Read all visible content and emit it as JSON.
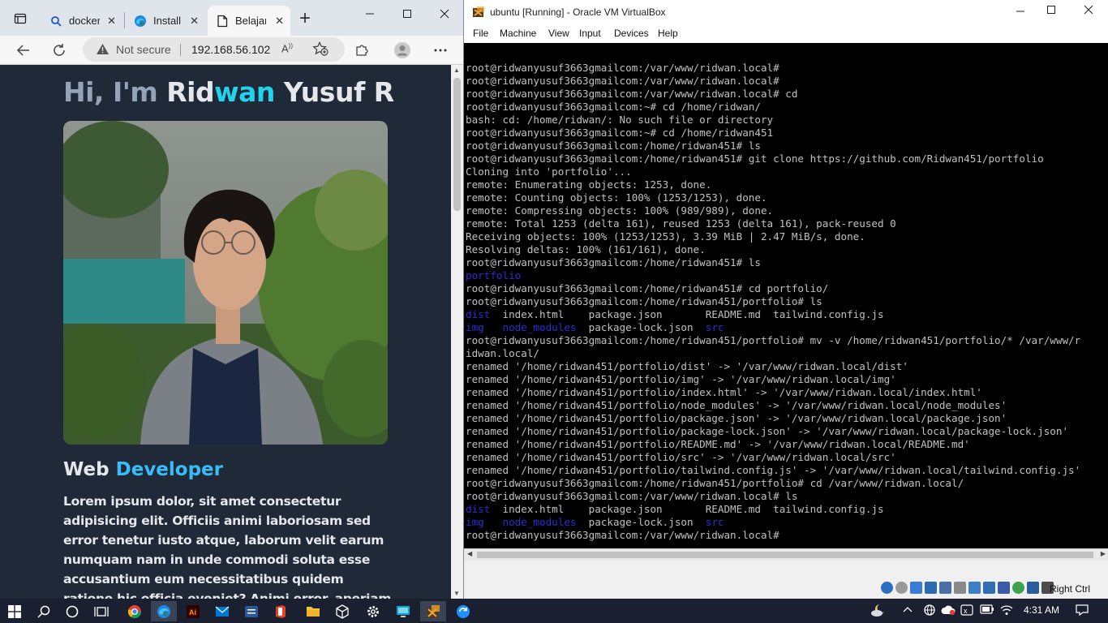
{
  "browser": {
    "tabs": [
      {
        "label": "docker",
        "icon": "search-icon"
      },
      {
        "label": "Install",
        "icon": "edge-icon"
      },
      {
        "label": "Belajar",
        "icon": "page-icon",
        "active": true
      }
    ],
    "address": {
      "security": "Not secure",
      "url": "192.168.56.102"
    },
    "page": {
      "greeting_prefix": "Hi, I'm ",
      "name_part1": "Rid",
      "name_part2": "wan",
      "name_part3": " Yusuf R",
      "role_prefix": "Web ",
      "role_accent": "Developer",
      "bio": "Lorem ipsum dolor, sit amet consectetur adipisicing elit. Officiis animi laboriosam sed error tenetur iusto atque, laborum velit earum numquam nam in unde commodi soluta esse accusantium eum necessitatibus quidem ratione hic officia eveniet? Animi error, aperiam earum tempore doloremque perferendis"
    }
  },
  "vbox": {
    "title": "ubuntu [Running] - Oracle VM VirtualBox",
    "menu": [
      "File",
      "Machine",
      "View",
      "Input",
      "Devices",
      "Help"
    ],
    "host_key": "Right Ctrl",
    "terminal_lines": [
      [
        {
          "t": "root@ridwanyusuf3663gmailcom:/var/www/ridwan.local#"
        }
      ],
      [
        {
          "t": "root@ridwanyusuf3663gmailcom:/var/www/ridwan.local#"
        }
      ],
      [
        {
          "t": "root@ridwanyusuf3663gmailcom:/var/www/ridwan.local# cd"
        }
      ],
      [
        {
          "t": "root@ridwanyusuf3663gmailcom:~# cd /home/ridwan/"
        }
      ],
      [
        {
          "t": "bash: cd: /home/ridwan/: No such file or directory"
        }
      ],
      [
        {
          "t": "root@ridwanyusuf3663gmailcom:~# cd /home/ridwan451"
        }
      ],
      [
        {
          "t": "root@ridwanyusuf3663gmailcom:/home/ridwan451# ls"
        }
      ],
      [
        {
          "t": "root@ridwanyusuf3663gmailcom:/home/ridwan451# git clone https://github.com/Ridwan451/portfolio"
        }
      ],
      [
        {
          "t": "Cloning into 'portfolio'..."
        }
      ],
      [
        {
          "t": "remote: Enumerating objects: 1253, done."
        }
      ],
      [
        {
          "t": "remote: Counting objects: 100% (1253/1253), done."
        }
      ],
      [
        {
          "t": "remote: Compressing objects: 100% (989/989), done."
        }
      ],
      [
        {
          "t": "remote: Total 1253 (delta 161), reused 1253 (delta 161), pack-reused 0"
        }
      ],
      [
        {
          "t": "Receiving objects: 100% (1253/1253), 3.39 MiB | 2.47 MiB/s, done."
        }
      ],
      [
        {
          "t": "Resolving deltas: 100% (161/161), done."
        }
      ],
      [
        {
          "t": "root@ridwanyusuf3663gmailcom:/home/ridwan451# ls"
        }
      ],
      [
        {
          "t": "portfolio",
          "c": "blue"
        }
      ],
      [
        {
          "t": "root@ridwanyusuf3663gmailcom:/home/ridwan451# cd portfolio/"
        }
      ],
      [
        {
          "t": "root@ridwanyusuf3663gmailcom:/home/ridwan451/portfolio# ls"
        }
      ],
      [
        {
          "t": "dist",
          "c": "blue"
        },
        {
          "t": "  index.html    package.json       README.md  tailwind.config.js"
        }
      ],
      [
        {
          "t": "img",
          "c": "blue"
        },
        {
          "t": "   "
        },
        {
          "t": "node_modules",
          "c": "blue"
        },
        {
          "t": "  package-lock.json  "
        },
        {
          "t": "src",
          "c": "blue"
        }
      ],
      [
        {
          "t": "root@ridwanyusuf3663gmailcom:/home/ridwan451/portfolio# mv -v /home/ridwan451/portfolio/* /var/www/r"
        }
      ],
      [
        {
          "t": "idwan.local/"
        }
      ],
      [
        {
          "t": "renamed '/home/ridwan451/portfolio/dist' -> '/var/www/ridwan.local/dist'"
        }
      ],
      [
        {
          "t": "renamed '/home/ridwan451/portfolio/img' -> '/var/www/ridwan.local/img'"
        }
      ],
      [
        {
          "t": "renamed '/home/ridwan451/portfolio/index.html' -> '/var/www/ridwan.local/index.html'"
        }
      ],
      [
        {
          "t": "renamed '/home/ridwan451/portfolio/node_modules' -> '/var/www/ridwan.local/node_modules'"
        }
      ],
      [
        {
          "t": "renamed '/home/ridwan451/portfolio/package.json' -> '/var/www/ridwan.local/package.json'"
        }
      ],
      [
        {
          "t": "renamed '/home/ridwan451/portfolio/package-lock.json' -> '/var/www/ridwan.local/package-lock.json'"
        }
      ],
      [
        {
          "t": "renamed '/home/ridwan451/portfolio/README.md' -> '/var/www/ridwan.local/README.md'"
        }
      ],
      [
        {
          "t": "renamed '/home/ridwan451/portfolio/src' -> '/var/www/ridwan.local/src'"
        }
      ],
      [
        {
          "t": "renamed '/home/ridwan451/portfolio/tailwind.config.js' -> '/var/www/ridwan.local/tailwind.config.js'"
        }
      ],
      [
        {
          "t": "root@ridwanyusuf3663gmailcom:/home/ridwan451/portfolio# cd /var/www/ridwan.local/"
        }
      ],
      [
        {
          "t": "root@ridwanyusuf3663gmailcom:/var/www/ridwan.local# ls"
        }
      ],
      [
        {
          "t": "dist",
          "c": "blue"
        },
        {
          "t": "  index.html    package.json       README.md  tailwind.config.js"
        }
      ],
      [
        {
          "t": "img",
          "c": "blue"
        },
        {
          "t": "   "
        },
        {
          "t": "node_modules",
          "c": "blue"
        },
        {
          "t": "  package-lock.json  "
        },
        {
          "t": "src",
          "c": "blue"
        }
      ],
      [
        {
          "t": "root@ridwanyusuf3663gmailcom:/var/www/ridwan.local#"
        }
      ]
    ]
  },
  "taskbar": {
    "time": "4:31 AM"
  },
  "colors": {
    "page_bg": "#1f2937",
    "accent_cyan": "#22d3ee",
    "accent_sky": "#38bdf8",
    "terminal_fg": "#c0c0c0",
    "terminal_dir": "#2b2bd6"
  }
}
